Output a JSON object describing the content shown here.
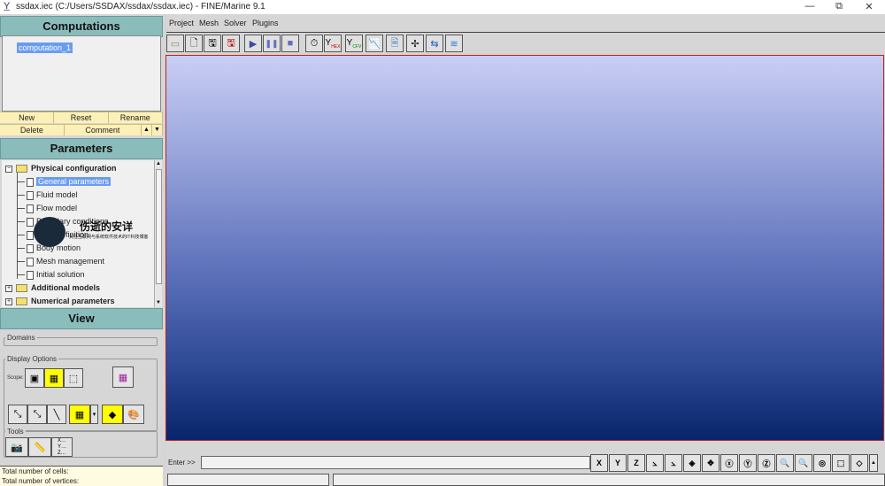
{
  "window": {
    "title": "ssdax.iec (C:/Users/SSDAX/ssdax/ssdax.iec) - FINE/Marine 9.1",
    "app_icon": "app-logo-icon",
    "controls": {
      "minimize": "—",
      "restore": "⧉",
      "close": "✕"
    }
  },
  "computations": {
    "header": "Computations",
    "items": [
      "computation_1"
    ],
    "buttons_row1": [
      "New",
      "Reset",
      "Rename"
    ],
    "buttons_row2": [
      "Delete",
      "Comment"
    ],
    "scroll_up": "▲",
    "scroll_down": "▼"
  },
  "parameters": {
    "header": "Parameters",
    "tree": [
      {
        "label": "Physical configuration",
        "expanded": true,
        "expander": "⊟",
        "children": [
          "General parameters",
          "Fluid model",
          "Flow model",
          "Boundary conditions",
          "Body definition",
          "Body motion",
          "Mesh management",
          "Initial solution"
        ]
      },
      {
        "label": "Additional models",
        "expanded": false,
        "expander": "⊞"
      },
      {
        "label": "Numerical parameters",
        "expanded": false,
        "expander": "⊞"
      }
    ],
    "selected": "General parameters",
    "expand_minus": "−",
    "expand_plus": "+"
  },
  "view": {
    "header": "View",
    "domains_label": "Domains",
    "display_options_label": "Display Options",
    "scope_label": "Scope:",
    "tools_label": "Tools",
    "tools_xyz": "X…\nY…\nZ…"
  },
  "status_info": {
    "cells_label": "Total number of cells:",
    "vertices_label": "Total number of vertices:"
  },
  "menu": [
    "Project",
    "Mesh",
    "Solver",
    "Plugins"
  ],
  "toolbar": {
    "buttons": [
      "open-project",
      "new-project",
      "save-project",
      "save-as-project",
      "start",
      "pause",
      "stop",
      "task-manager",
      "monitor-hex",
      "monitor-cfv",
      "monitor-convergence",
      "report",
      "fan",
      "transfer",
      "waves"
    ],
    "glyphs": [
      "📂",
      "📄",
      "💾",
      "🖫",
      "▶",
      "❚❚",
      "■",
      "⏱",
      "Y",
      "Y",
      "📉",
      "🗎",
      "✢",
      "⇆",
      "≋"
    ]
  },
  "command": {
    "label": "Enter >>",
    "value": ""
  },
  "view_buttons": [
    "X",
    "Y",
    "Z",
    "⟂",
    "⟂",
    "⟡",
    "✥",
    "⟲",
    "⟲",
    "⟲",
    "🔍",
    "🔍",
    "▢",
    "⬚",
    "◇"
  ],
  "watermark": {
    "title": "伤逝的安详",
    "subtitle": "关注互联网与系统软件技术的IT科技博客"
  },
  "colors": {
    "panel_header": "#8bbcbc",
    "button_row": "#fdf0b6",
    "selection": "#6a9cf0",
    "viewport_top": "#c9cef4",
    "viewport_bottom": "#08246a",
    "viewport_border": "#c02020",
    "active_toggle": "#ffff00"
  }
}
